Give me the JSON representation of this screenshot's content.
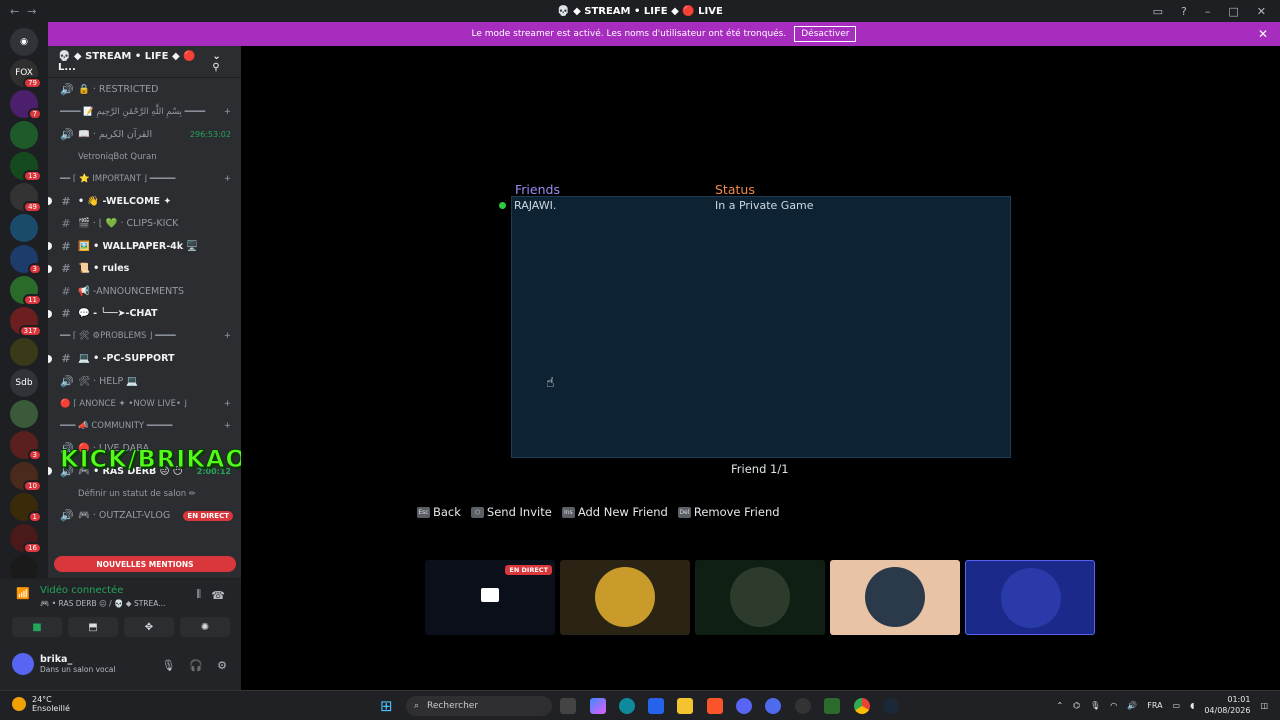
{
  "window": {
    "title": "💀 ◆ STREAM • LIFE ◆ 🔴 LIVE"
  },
  "banner": {
    "message": "Le mode streamer est activé. Les noms d'utilisateur ont été tronqués.",
    "button": "Désactiver"
  },
  "guild_badges": [
    "79",
    "7",
    "",
    "13",
    "49",
    "",
    "3",
    "11",
    "317",
    "",
    "",
    "",
    "3",
    "10",
    "1",
    "16",
    ""
  ],
  "guild_label_sdb": "Sdb",
  "guild_label_fox": "FOX",
  "server": {
    "name": "💀 ◆ STREAM • LIFE ◆ 🔴 L..."
  },
  "channels": [
    {
      "icon": "🔊",
      "label": "🔒 · RESTRICTED",
      "style": "muted"
    },
    {
      "icon": "",
      "label": "━━━━ 📝 بِسْمِ اللَّهِ الرَّحْمَٰنِ الرَّحِيمِ ━━━━",
      "style": "cat"
    },
    {
      "icon": "🔊",
      "label": "📖 · القرآن الكريم",
      "style": "muted",
      "time": "296:53:02"
    },
    {
      "icon": "",
      "label": "VetroniqBot Quran",
      "style": "sub"
    },
    {
      "icon": "",
      "label": "━━ ⌈ ⭐ IMPORTANT ⌋ ━━━━━",
      "style": "cat"
    },
    {
      "icon": "#",
      "label": "• 👋 -WELCOME ✦",
      "style": "bold"
    },
    {
      "icon": "#",
      "label": "🎬 · ⌊ 💚 · CLIPS-KICK",
      "style": "muted"
    },
    {
      "icon": "#",
      "label": "🖼️ • WALLPAPER-4k 🖥️",
      "style": "bold"
    },
    {
      "icon": "#",
      "label": "📜 • rules",
      "style": "bold"
    },
    {
      "icon": "#",
      "label": "📢 -ANNOUNCEMENTS",
      "style": "muted"
    },
    {
      "icon": "#",
      "label": "💬 - ╰──➤-CHAT",
      "style": "bold"
    },
    {
      "icon": "",
      "label": "━━ ⌈ 🛠 ⚙PROBLEMS ⌋ ━━━━",
      "style": "cat"
    },
    {
      "icon": "#",
      "label": "💻 • -PC-SUPPORT",
      "style": "bold"
    },
    {
      "icon": "🔊",
      "label": "🛠 · HELP 💻",
      "style": "muted"
    },
    {
      "icon": "",
      "label": "🔴 ⌈ ANONCE ✦ •NOW LIVE• ⌋",
      "style": "cat"
    },
    {
      "icon": "",
      "label": "━━━ 📣 COMMUNITY ━━━━━",
      "style": "cat"
    },
    {
      "icon": "🔊",
      "label": "🔴 · LIVE DABA",
      "style": "muted"
    },
    {
      "icon": "🔊",
      "label": "🎮 • RAS DERB 😐 😶",
      "style": "bold",
      "time": "2:00:12"
    },
    {
      "icon": "",
      "label": "Définir un statut de salon ✏",
      "style": "sub"
    },
    {
      "icon": "🔊",
      "label": "🎮 · OUTZALT-VLOG",
      "style": "muted",
      "tag": "EN DIRECT"
    }
  ],
  "kick_overlay": "KICK/BRIKAO",
  "mentions": "NOUVELLES MENTIONS",
  "voice": {
    "status": "Vidéo connectée",
    "channel": "🎮 • RAS DERB 😐 / 💀 ◆ STREA...",
    "user_name": "brika_",
    "user_status": "Dans un salon vocal"
  },
  "game": {
    "header_friends": "Friends",
    "header_status": "Status",
    "friend_name": "RAJAWI.",
    "friend_status": "In a Private Game",
    "counter": "Friend 1/1",
    "actions": [
      {
        "key": "Esc",
        "label": "Back"
      },
      {
        "key": "⬡",
        "label": "Send Invite"
      },
      {
        "key": "Ins",
        "label": "Add New Friend"
      },
      {
        "key": "Del",
        "label": "Remove Friend"
      }
    ]
  },
  "tiles": [
    {
      "live": "EN DIRECT",
      "bg": "#0b0f1a"
    },
    {
      "live": "",
      "bg": "#2b2414"
    },
    {
      "live": "",
      "bg": "#0f1f14"
    },
    {
      "live": "",
      "bg": "#e9c3a5"
    },
    {
      "live": "",
      "bg": "#1b2a8a"
    }
  ],
  "taskbar": {
    "temperature": "24°C",
    "weather": "Ensoleillé",
    "search": "Rechercher",
    "lang": "FRA",
    "time": "01:01",
    "date": "04/08/2026"
  }
}
